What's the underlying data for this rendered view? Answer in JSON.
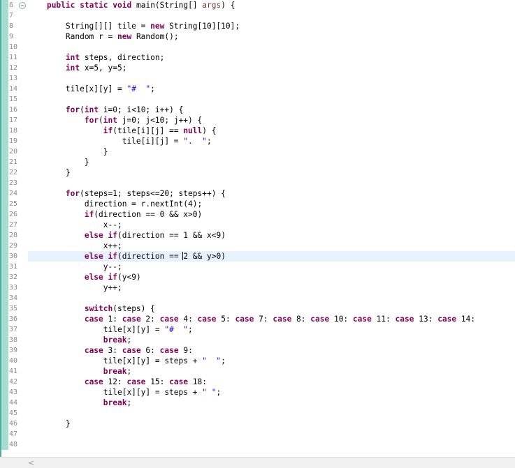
{
  "editor": {
    "current_line": 30,
    "lines": [
      {
        "n": 6,
        "fold": "⊖",
        "tokens": [
          {
            "t": "    "
          },
          {
            "t": "public",
            "c": "kw"
          },
          {
            "t": " "
          },
          {
            "t": "static",
            "c": "kw"
          },
          {
            "t": " "
          },
          {
            "t": "void",
            "c": "kw"
          },
          {
            "t": " main(String[] "
          },
          {
            "t": "args",
            "c": "param"
          },
          {
            "t": ") {"
          }
        ]
      },
      {
        "n": 7,
        "tokens": []
      },
      {
        "n": 8,
        "tokens": [
          {
            "t": "        String[][] tile = "
          },
          {
            "t": "new",
            "c": "kw"
          },
          {
            "t": " String[10][10];"
          }
        ]
      },
      {
        "n": 9,
        "tokens": [
          {
            "t": "        Random r = "
          },
          {
            "t": "new",
            "c": "kw"
          },
          {
            "t": " Random();"
          }
        ]
      },
      {
        "n": 10,
        "tokens": []
      },
      {
        "n": 11,
        "tokens": [
          {
            "t": "        "
          },
          {
            "t": "int",
            "c": "kw"
          },
          {
            "t": " steps, direction;"
          }
        ]
      },
      {
        "n": 12,
        "tokens": [
          {
            "t": "        "
          },
          {
            "t": "int",
            "c": "kw"
          },
          {
            "t": " x=5, y=5;"
          }
        ]
      },
      {
        "n": 13,
        "tokens": []
      },
      {
        "n": 14,
        "tokens": [
          {
            "t": "        tile[x][y] = "
          },
          {
            "t": "\"#  \"",
            "c": "str"
          },
          {
            "t": ";"
          }
        ]
      },
      {
        "n": 15,
        "tokens": []
      },
      {
        "n": 16,
        "tokens": [
          {
            "t": "        "
          },
          {
            "t": "for",
            "c": "kw"
          },
          {
            "t": "("
          },
          {
            "t": "int",
            "c": "kw"
          },
          {
            "t": " i=0; i<10; i++) {"
          }
        ]
      },
      {
        "n": 17,
        "tokens": [
          {
            "t": "            "
          },
          {
            "t": "for",
            "c": "kw"
          },
          {
            "t": "("
          },
          {
            "t": "int",
            "c": "kw"
          },
          {
            "t": " j=0; j<10; j++) {"
          }
        ]
      },
      {
        "n": 18,
        "tokens": [
          {
            "t": "                "
          },
          {
            "t": "if",
            "c": "kw"
          },
          {
            "t": "(tile[i][j] == "
          },
          {
            "t": "null",
            "c": "kw"
          },
          {
            "t": ") {"
          }
        ]
      },
      {
        "n": 19,
        "tokens": [
          {
            "t": "                    tile[i][j] = "
          },
          {
            "t": "\".  \"",
            "c": "str"
          },
          {
            "t": ";"
          }
        ]
      },
      {
        "n": 20,
        "tokens": [
          {
            "t": "                }"
          }
        ]
      },
      {
        "n": 21,
        "tokens": [
          {
            "t": "            }"
          }
        ]
      },
      {
        "n": 22,
        "tokens": [
          {
            "t": "        }"
          }
        ]
      },
      {
        "n": 23,
        "tokens": []
      },
      {
        "n": 24,
        "tokens": [
          {
            "t": "        "
          },
          {
            "t": "for",
            "c": "kw"
          },
          {
            "t": "(steps=1; steps<=20; steps++) {"
          }
        ]
      },
      {
        "n": 25,
        "tokens": [
          {
            "t": "            direction = r.nextInt(4);"
          }
        ]
      },
      {
        "n": 26,
        "tokens": [
          {
            "t": "            "
          },
          {
            "t": "if",
            "c": "kw"
          },
          {
            "t": "(direction == 0 && x>0)"
          }
        ]
      },
      {
        "n": 27,
        "tokens": [
          {
            "t": "                x--;"
          }
        ]
      },
      {
        "n": 28,
        "tokens": [
          {
            "t": "            "
          },
          {
            "t": "else",
            "c": "kw"
          },
          {
            "t": " "
          },
          {
            "t": "if",
            "c": "kw"
          },
          {
            "t": "(direction == 1 && x<9)"
          }
        ]
      },
      {
        "n": 29,
        "tokens": [
          {
            "t": "                x++;"
          }
        ]
      },
      {
        "n": 30,
        "tokens": [
          {
            "t": "            "
          },
          {
            "t": "else",
            "c": "kw"
          },
          {
            "t": " "
          },
          {
            "t": "if",
            "c": "kw"
          },
          {
            "t": "(direction == "
          },
          {
            "caret": true
          },
          {
            "t": "2 && y>0)"
          }
        ]
      },
      {
        "n": 31,
        "tokens": [
          {
            "t": "                y--;"
          }
        ]
      },
      {
        "n": 32,
        "tokens": [
          {
            "t": "            "
          },
          {
            "t": "else",
            "c": "kw"
          },
          {
            "t": " "
          },
          {
            "t": "if",
            "c": "kw"
          },
          {
            "t": "(y<9)"
          }
        ]
      },
      {
        "n": 33,
        "tokens": [
          {
            "t": "                y++;"
          }
        ]
      },
      {
        "n": 34,
        "tokens": []
      },
      {
        "n": 35,
        "tokens": [
          {
            "t": "            "
          },
          {
            "t": "switch",
            "c": "kw"
          },
          {
            "t": "(steps) {"
          }
        ]
      },
      {
        "n": 36,
        "tokens": [
          {
            "t": "            "
          },
          {
            "t": "case",
            "c": "kw"
          },
          {
            "t": " 1: "
          },
          {
            "t": "case",
            "c": "kw"
          },
          {
            "t": " 2: "
          },
          {
            "t": "case",
            "c": "kw"
          },
          {
            "t": " 4: "
          },
          {
            "t": "case",
            "c": "kw"
          },
          {
            "t": " 5: "
          },
          {
            "t": "case",
            "c": "kw"
          },
          {
            "t": " 7: "
          },
          {
            "t": "case",
            "c": "kw"
          },
          {
            "t": " 8: "
          },
          {
            "t": "case",
            "c": "kw"
          },
          {
            "t": " 10: "
          },
          {
            "t": "case",
            "c": "kw"
          },
          {
            "t": " 11: "
          },
          {
            "t": "case",
            "c": "kw"
          },
          {
            "t": " 13: "
          },
          {
            "t": "case",
            "c": "kw"
          },
          {
            "t": " 14:"
          }
        ]
      },
      {
        "n": 37,
        "tokens": [
          {
            "t": "                tile[x][y] = "
          },
          {
            "t": "\"#  \"",
            "c": "str"
          },
          {
            "t": ";"
          }
        ]
      },
      {
        "n": 38,
        "tokens": [
          {
            "t": "                "
          },
          {
            "t": "break",
            "c": "kw"
          },
          {
            "t": ";"
          }
        ]
      },
      {
        "n": 39,
        "tokens": [
          {
            "t": "            "
          },
          {
            "t": "case",
            "c": "kw"
          },
          {
            "t": " 3: "
          },
          {
            "t": "case",
            "c": "kw"
          },
          {
            "t": " 6: "
          },
          {
            "t": "case",
            "c": "kw"
          },
          {
            "t": " 9:"
          }
        ]
      },
      {
        "n": 40,
        "tokens": [
          {
            "t": "                tile[x][y] = steps + "
          },
          {
            "t": "\"  \"",
            "c": "str"
          },
          {
            "t": ";"
          }
        ]
      },
      {
        "n": 41,
        "tokens": [
          {
            "t": "                "
          },
          {
            "t": "break",
            "c": "kw"
          },
          {
            "t": ";"
          }
        ]
      },
      {
        "n": 42,
        "tokens": [
          {
            "t": "            "
          },
          {
            "t": "case",
            "c": "kw"
          },
          {
            "t": " 12: "
          },
          {
            "t": "case",
            "c": "kw"
          },
          {
            "t": " 15: "
          },
          {
            "t": "case",
            "c": "kw"
          },
          {
            "t": " 18:"
          }
        ]
      },
      {
        "n": 43,
        "tokens": [
          {
            "t": "                tile[x][y] = steps + "
          },
          {
            "t": "\" \"",
            "c": "str"
          },
          {
            "t": ";"
          }
        ]
      },
      {
        "n": 44,
        "tokens": [
          {
            "t": "                "
          },
          {
            "t": "break",
            "c": "kw"
          },
          {
            "t": ";"
          }
        ]
      },
      {
        "n": 45,
        "tokens": []
      },
      {
        "n": 46,
        "tokens": [
          {
            "t": "        }"
          }
        ]
      },
      {
        "n": 47,
        "tokens": []
      },
      {
        "n": 48,
        "tokens": []
      }
    ]
  },
  "scrollbar": {
    "left_arrow": "<"
  }
}
